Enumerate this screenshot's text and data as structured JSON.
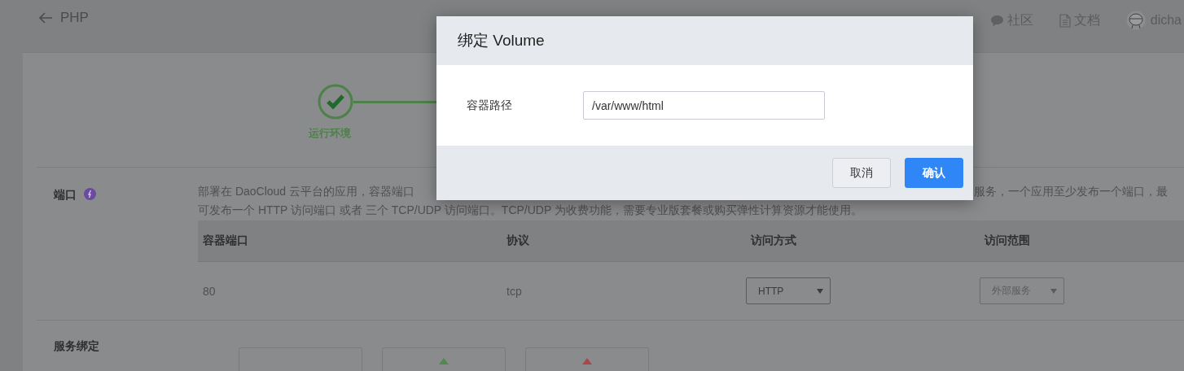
{
  "header": {
    "back_label": "PHP",
    "links": [
      {
        "kind": "community",
        "label": "社区"
      },
      {
        "kind": "docs",
        "label": "文档"
      }
    ],
    "user": {
      "name": "dicha"
    }
  },
  "stepper": {
    "steps": [
      {
        "label": "运行环境",
        "done": true
      }
    ]
  },
  "ports": {
    "title": "端口",
    "description": [
      "部署在 DaoCloud 云平台的应用，容器端口",
      "服务，一个应用至少发布一个端口，最",
      "可发布一个 HTTP 访问端口 或者 三个 TCP/UDP 访问端口。TCP/UDP 为收费功能，需要专业版套餐或购买弹性计算资源才能使用。"
    ],
    "table": {
      "columns": [
        "容器端口",
        "协议",
        "访问方式",
        "访问范围"
      ],
      "rows": [
        {
          "port": "80",
          "protocol": "tcp",
          "access": "HTTP",
          "scope": "外部服务"
        }
      ]
    }
  },
  "service_binding": {
    "title": "服务绑定",
    "cards": [
      {
        "kind": "blank"
      },
      {
        "kind": "icon",
        "color": "#4f8a4f"
      },
      {
        "kind": "icon",
        "color": "#a84848"
      }
    ]
  },
  "modal": {
    "title": "绑定 Volume",
    "field": {
      "label": "容器路径",
      "value": "/var/www/html"
    },
    "buttons": [
      {
        "label": "取消",
        "primary": false
      },
      {
        "label": "确认",
        "primary": true
      }
    ]
  }
}
